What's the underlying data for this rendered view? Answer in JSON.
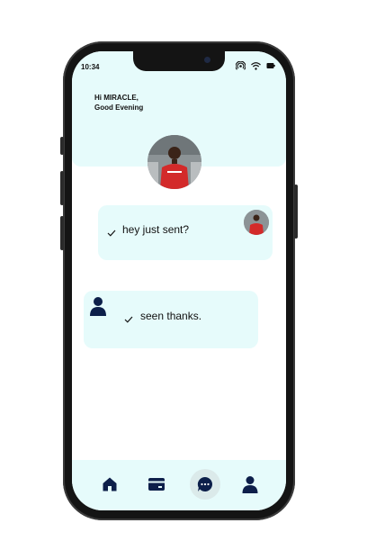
{
  "status_bar": {
    "time": "10:34",
    "icons": [
      "hotspot-icon",
      "wifi-icon",
      "battery-icon"
    ]
  },
  "header": {
    "greeting_line1": "Hi MIRACLE,",
    "greeting_line2": "Good Evening"
  },
  "messages": [
    {
      "text": "hey just sent?",
      "sender": "photo-user",
      "status": "check-icon"
    },
    {
      "text": "seen thanks.",
      "sender": "default-user",
      "status": "check-icon"
    }
  ],
  "bottom_nav": {
    "items": [
      "home-icon",
      "wallet-icon",
      "chat-icon",
      "profile-icon"
    ],
    "active": "chat-icon"
  },
  "colors": {
    "accent": "#0d1f4a",
    "panel": "#e6fbfb",
    "frame": "#141414"
  }
}
